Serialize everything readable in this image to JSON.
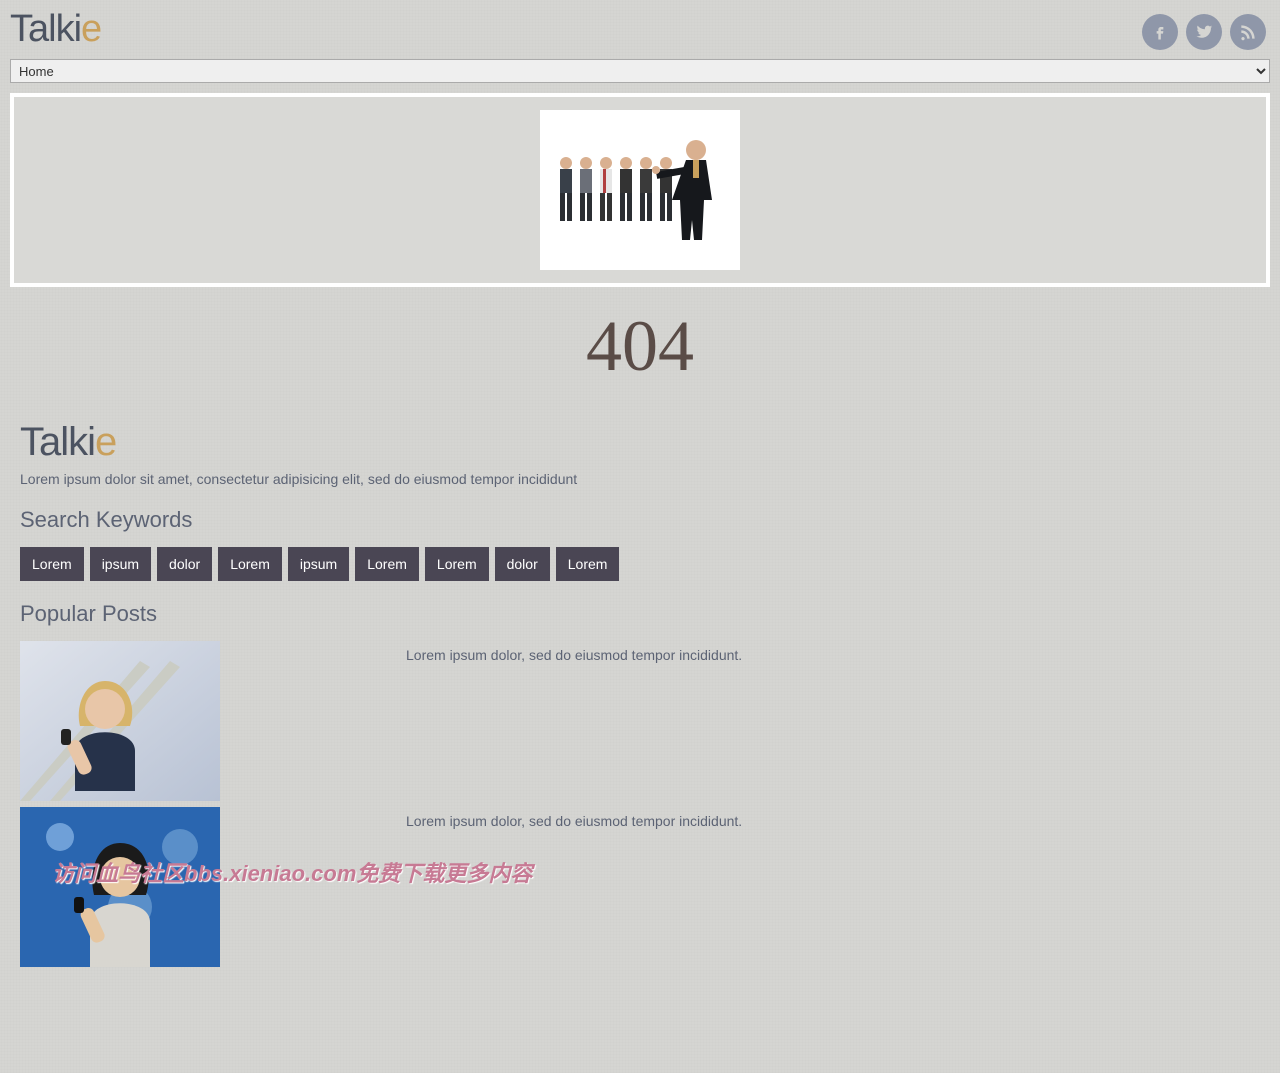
{
  "brand": {
    "part1": "Talki",
    "part2": "e"
  },
  "nav": {
    "selected": "Home"
  },
  "error": {
    "code": "404"
  },
  "footer": {
    "brand": {
      "part1": "Talki",
      "part2": "e"
    },
    "tagline": "Lorem ipsum dolor sit amet, consectetur adipisicing elit, sed do eiusmod tempor incididunt"
  },
  "sections": {
    "search_heading": "Search Keywords",
    "popular_heading": "Popular Posts"
  },
  "tags": [
    "Lorem",
    "ipsum",
    "dolor",
    "Lorem",
    "ipsum",
    "Lorem",
    "Lorem",
    "dolor",
    "Lorem"
  ],
  "posts": [
    {
      "title": "Lorem ipsum dolor, sed do eiusmod tempor incididunt."
    },
    {
      "title": "Lorem ipsum dolor, sed do eiusmod tempor incididunt."
    }
  ],
  "social": {
    "facebook": "facebook-icon",
    "twitter": "twitter-icon",
    "rss": "rss-icon"
  },
  "watermark": "访问血鸟社区bbs.xieniao.com免费下载更多内容"
}
